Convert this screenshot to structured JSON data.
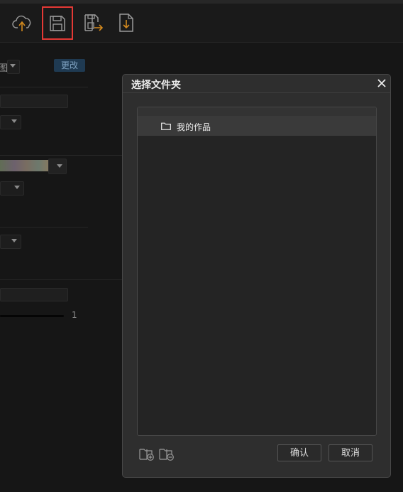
{
  "toolbar": {
    "items": [
      {
        "icon": "cloud-upload-icon"
      },
      {
        "icon": "save-icon",
        "highlighted": true
      },
      {
        "icon": "save-as-icon"
      },
      {
        "icon": "export-file-icon"
      }
    ]
  },
  "background_panel": {
    "type_fragment": "图",
    "change_button": "更改",
    "slider_value": "1"
  },
  "dialog": {
    "title": "选择文件夹",
    "tree": {
      "items": [
        {
          "label": "我的作品",
          "icon": "folder-icon",
          "selected": true
        }
      ]
    },
    "footer": {
      "new_folder_icon": "folder-add-icon",
      "delete_folder_icon": "folder-remove-icon",
      "confirm_label": "确认",
      "cancel_label": "取消"
    }
  },
  "colors": {
    "accent_highlight": "#e53935",
    "icon_stroke": "#9a9a9a",
    "icon_arrow": "#d48a1e",
    "dialog_bg": "#2e2e2e",
    "selected_row": "#3a3a3a"
  }
}
